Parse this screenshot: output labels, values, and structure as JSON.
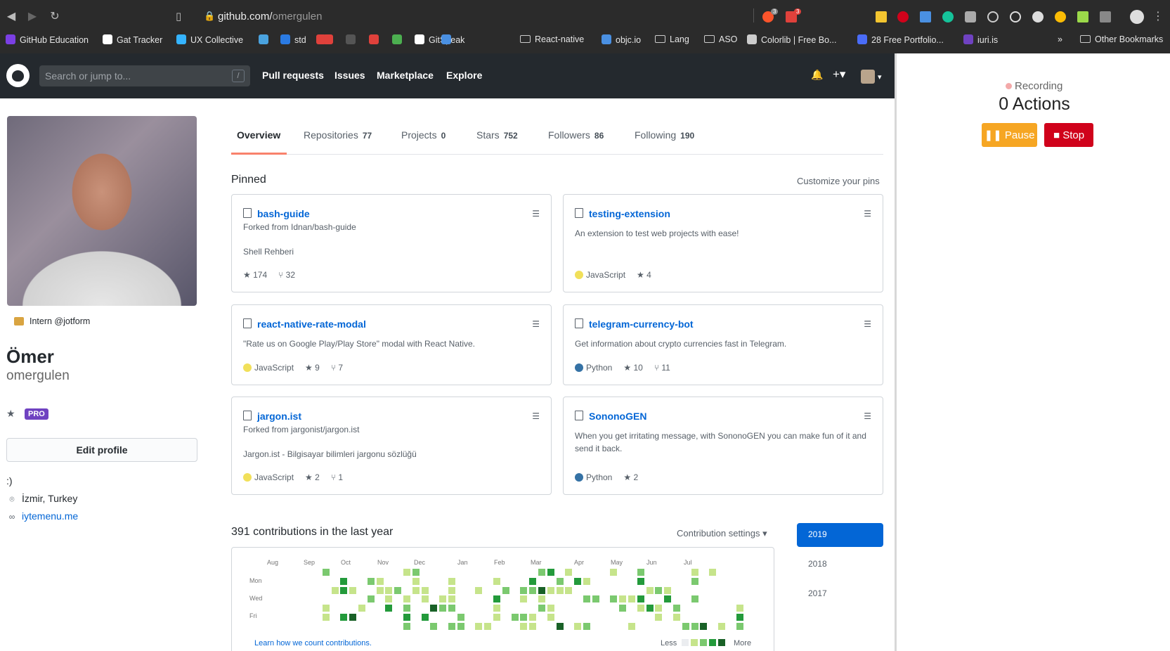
{
  "browser": {
    "url_domain": "github.com/",
    "url_path": "omergulen",
    "bookmarks": [
      {
        "label": "GitHub Education",
        "color": "#7b3fe4"
      },
      {
        "label": "Gat Tracker",
        "color": "#ffffff"
      },
      {
        "label": "UX Collective",
        "color": "#35b4ff"
      },
      {
        "label": "",
        "color": "#4aa3df"
      },
      {
        "label": "std",
        "color": "#2a7ae2"
      },
      {
        "label": "",
        "color": "#e0413b"
      },
      {
        "label": "",
        "color": "#e0413b"
      },
      {
        "label": "",
        "color": "#555555"
      },
      {
        "label": "",
        "color": "#e0413b"
      },
      {
        "label": "",
        "color": "#4caf50"
      },
      {
        "label": "GitSpeak",
        "color": "#ffffff"
      },
      {
        "label": "",
        "color": "#4a90e2"
      },
      {
        "label": "React-native",
        "color": "folder"
      },
      {
        "label": "objc.io",
        "color": "#4a90e2"
      },
      {
        "label": "Lang",
        "color": "folder"
      },
      {
        "label": "ASO",
        "color": "folder"
      },
      {
        "label": "Colorlib | Free Bo...",
        "color": "#cccccc"
      },
      {
        "label": "28 Free Portfolio...",
        "color": "#4a6cf7"
      },
      {
        "label": "iuri.is",
        "color": "#6f42c1"
      }
    ],
    "overflow": "»",
    "other_bookmarks": "Other Bookmarks",
    "badge_a": "3",
    "badge_b": "3"
  },
  "header": {
    "search_placeholder": "Search or jump to...",
    "slash": "/",
    "nav": [
      "Pull requests",
      "Issues",
      "Marketplace",
      "Explore"
    ],
    "bell": "🔔",
    "plus": "+▾",
    "avatar_caret": "▾"
  },
  "recorder": {
    "status": "Recording",
    "count": "0 Actions",
    "pause": "Pause",
    "stop": "Stop",
    "pause_color": "#f6a623",
    "stop_color": "#d0021b"
  },
  "profile": {
    "org": "Intern @jotform",
    "name": "Ömer",
    "login": "omergulen",
    "badge": "PRO",
    "edit_button": "Edit profile",
    "bio": ":)",
    "location": "İzmir, Turkey",
    "website": "iytemenu.me"
  },
  "tabs": [
    {
      "label": "Overview",
      "count": ""
    },
    {
      "label": "Repositories",
      "count": "77"
    },
    {
      "label": "Projects",
      "count": "0"
    },
    {
      "label": "Stars",
      "count": "752"
    },
    {
      "label": "Followers",
      "count": "86"
    },
    {
      "label": "Following",
      "count": "190"
    }
  ],
  "pinned": {
    "title": "Pinned",
    "customize": "Customize your pins",
    "cards": [
      {
        "title": "bash-guide",
        "forked": "Forked from Idnan/bash-guide",
        "desc": "Shell Rehberi",
        "lang": "",
        "lang_color": "",
        "stars": "174",
        "forks": "32"
      },
      {
        "title": "testing-extension",
        "forked": "",
        "desc": "An extension to test web projects with ease!",
        "lang": "JavaScript",
        "lang_color": "#f1e05a",
        "stars": "4",
        "forks": ""
      },
      {
        "title": "react-native-rate-modal",
        "forked": "",
        "desc": "\"Rate us on Google Play/Play Store\" modal with React Native.",
        "lang": "JavaScript",
        "lang_color": "#f1e05a",
        "stars": "9",
        "forks": "7"
      },
      {
        "title": "telegram-currency-bot",
        "forked": "",
        "desc": "Get information about crypto currencies fast in Telegram.",
        "lang": "Python",
        "lang_color": "#3572A5",
        "stars": "10",
        "forks": "11"
      },
      {
        "title": "jargon.ist",
        "forked": "Forked from jargonist/jargon.ist",
        "desc": "Jargon.ist - Bilgisayar bilimleri jargonu sözlüğü",
        "lang": "JavaScript",
        "lang_color": "#f1e05a",
        "stars": "2",
        "forks": "1"
      },
      {
        "title": "SononoGEN",
        "forked": "",
        "desc": "When you get irritating message, with SononoGEN you can make fun of it and send it back.",
        "lang": "Python",
        "lang_color": "#3572A5",
        "stars": "2",
        "forks": ""
      }
    ]
  },
  "contributions": {
    "title": "391 contributions in the last year",
    "settings": "Contribution settings ▾",
    "months": [
      "Aug",
      "Sep",
      "Oct",
      "Nov",
      "Dec",
      "Jan",
      "Feb",
      "Mar",
      "Apr",
      "May",
      "Jun",
      "Jul"
    ],
    "weekdays": [
      "Mon",
      "Wed",
      "Fri"
    ],
    "learn": "Learn how we count contributions.",
    "less": "Less",
    "more": "More",
    "levels": [
      "#ebedf0",
      "#c6e48b",
      "#7bc96f",
      "#239a3b",
      "#196127"
    ],
    "years": [
      "2019",
      "2018",
      "2017"
    ]
  }
}
